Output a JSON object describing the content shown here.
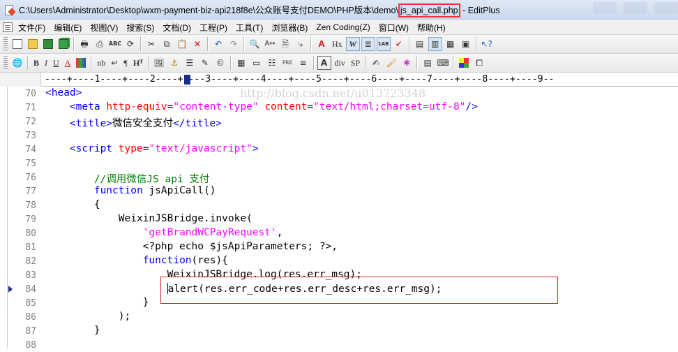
{
  "window": {
    "title_path": "C:\\Users\\Administrator\\Desktop\\wxm-payment-biz-api218f8e\\公众账号支付DEMO\\PHP版本\\demo\\",
    "title_file": "js_api_call.php",
    "title_app": " - EditPlus"
  },
  "menu": [
    "文件(F)",
    "编辑(E)",
    "视图(V)",
    "搜索(S)",
    "文档(D)",
    "工程(P)",
    "工具(T)",
    "浏览器(B)",
    "Zen Coding(Z)",
    "窗口(W)",
    "帮助(H)"
  ],
  "toolbar2_text": {
    "bold": "B",
    "italic": "I",
    "underline": "U",
    "font_color": "A",
    "nb": "nb",
    "br": "↵",
    "pilcrow": "¶",
    "heading": "Hᵀ",
    "pre": "PRE",
    "div": "div",
    "sp": "SP",
    "hx": "Hx"
  },
  "ruler": "----+----1----+----2----+----3----+----4----+----5----+----6----+----7----+----8----+----9--",
  "watermark": "http://blog.csdn.net/u013723348",
  "lines": [
    {
      "n": "70",
      "segs": [
        [
          "tag",
          "<head>"
        ]
      ]
    },
    {
      "n": "71",
      "segs": [
        [
          "plain",
          "    "
        ],
        [
          "tag",
          "<meta "
        ],
        [
          "attr",
          "http-equiv"
        ],
        [
          "plain",
          "="
        ],
        [
          "str",
          "\"content-type\""
        ],
        [
          "plain",
          " "
        ],
        [
          "attr",
          "content"
        ],
        [
          "plain",
          "="
        ],
        [
          "str",
          "\"text/html;charset=utf-8\""
        ],
        [
          "tag",
          "/>"
        ]
      ]
    },
    {
      "n": "72",
      "segs": [
        [
          "plain",
          "    "
        ],
        [
          "tag",
          "<title>"
        ],
        [
          "plain",
          "微信安全支付"
        ],
        [
          "tag",
          "</title>"
        ]
      ]
    },
    {
      "n": "73",
      "segs": []
    },
    {
      "n": "74",
      "segs": [
        [
          "plain",
          "    "
        ],
        [
          "tag",
          "<script "
        ],
        [
          "attr",
          "type"
        ],
        [
          "plain",
          "="
        ],
        [
          "str",
          "\"text/javascript\""
        ],
        [
          "tag",
          ">"
        ]
      ]
    },
    {
      "n": "75",
      "segs": []
    },
    {
      "n": "76",
      "segs": [
        [
          "plain",
          "        "
        ],
        [
          "cmt",
          "//调用微信JS api 支付"
        ]
      ]
    },
    {
      "n": "77",
      "segs": [
        [
          "plain",
          "        "
        ],
        [
          "kw",
          "function"
        ],
        [
          "plain",
          " jsApiCall()"
        ]
      ]
    },
    {
      "n": "78",
      "segs": [
        [
          "plain",
          "        {"
        ]
      ]
    },
    {
      "n": "79",
      "segs": [
        [
          "plain",
          "            WeixinJSBridge.invoke("
        ]
      ]
    },
    {
      "n": "80",
      "segs": [
        [
          "plain",
          "                "
        ],
        [
          "str",
          "'getBrandWCPayRequest'"
        ],
        [
          "plain",
          ","
        ]
      ]
    },
    {
      "n": "81",
      "segs": [
        [
          "plain",
          "                <?php echo $jsApiParameters; ?>,"
        ]
      ]
    },
    {
      "n": "82",
      "segs": [
        [
          "plain",
          "                "
        ],
        [
          "kw",
          "function"
        ],
        [
          "plain",
          "(res){"
        ]
      ]
    },
    {
      "n": "83",
      "segs": [
        [
          "plain",
          "                    WeixinJSBridge.log(res.err_msg);"
        ]
      ]
    },
    {
      "n": "84",
      "segs": [
        [
          "plain",
          "                    "
        ],
        [
          "caret",
          ""
        ],
        [
          "plain",
          "alert(res.err_code+res.err_desc+res.err_msg);"
        ]
      ],
      "bookmark": true
    },
    {
      "n": "85",
      "segs": [
        [
          "plain",
          "                }"
        ]
      ]
    },
    {
      "n": "86",
      "segs": [
        [
          "plain",
          "            );"
        ]
      ]
    },
    {
      "n": "87",
      "segs": [
        [
          "plain",
          "        }"
        ]
      ]
    },
    {
      "n": "88",
      "segs": []
    }
  ]
}
